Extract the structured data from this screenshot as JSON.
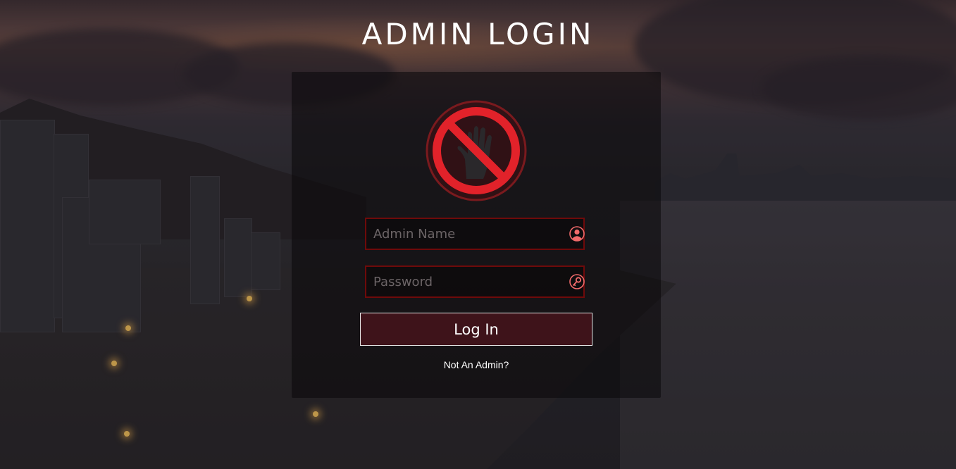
{
  "page": {
    "title": "ADMIN LOGIN"
  },
  "form": {
    "admin_name": {
      "placeholder": "Admin Name",
      "value": "",
      "icon": "user-circle-icon"
    },
    "password": {
      "placeholder": "Password",
      "value": "",
      "icon": "key-icon"
    },
    "login_label": "Log In",
    "not_admin_link": "Not An Admin?",
    "logo_icon": "stop-hand-icon"
  },
  "colors": {
    "accent_red": "#e2222a",
    "field_border": "#6e0a0a",
    "icon_pink": "#f26b6b",
    "text_white": "#ffffff"
  }
}
